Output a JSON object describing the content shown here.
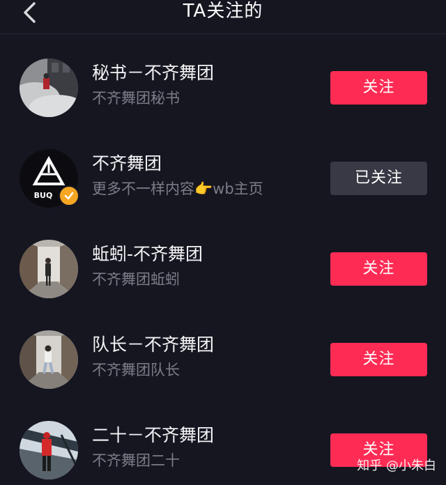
{
  "header": {
    "title": "TA关注的",
    "back_icon": "chevron-left-icon"
  },
  "colors": {
    "background": "#161621",
    "follow_button": "#fe2c55",
    "followed_button": "#393945",
    "verified_badge": "#f5a623",
    "subtitle_text": "#7d7d88"
  },
  "users": [
    {
      "name": "秘书－不齐舞团",
      "subtitle": "不齐舞团秘书",
      "button_label": "关注",
      "followed": false,
      "verified": false
    },
    {
      "name": "不齐舞团",
      "subtitle": "更多不一样内容👉wb主页",
      "button_label": "已关注",
      "followed": true,
      "verified": true
    },
    {
      "name": "蚯蚓-不齐舞团",
      "subtitle": "不齐舞团蚯蚓",
      "button_label": "关注",
      "followed": false,
      "verified": false
    },
    {
      "name": "队长－不齐舞团",
      "subtitle": "不齐舞团队长",
      "button_label": "关注",
      "followed": false,
      "verified": false
    },
    {
      "name": "二十－不齐舞团",
      "subtitle": "不齐舞团二十",
      "button_label": "关注",
      "followed": false,
      "verified": false
    }
  ],
  "watermark": "知乎 @小朱白"
}
